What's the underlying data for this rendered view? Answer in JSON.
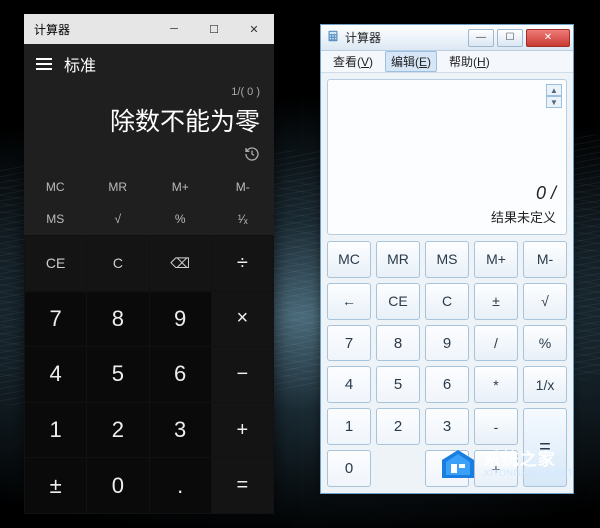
{
  "win10": {
    "title": "计算器",
    "mode": "标准",
    "expression": "1/( 0 )",
    "result": "除数不能为零",
    "history_icon": "history-icon",
    "memory_row": [
      "MC",
      "MR",
      "M+",
      "M-"
    ],
    "func_row": [
      "MS",
      "√",
      "%",
      "¹⁄ₓ"
    ],
    "keypad": [
      {
        "label": "CE",
        "cls": "fn"
      },
      {
        "label": "C",
        "cls": "fn"
      },
      {
        "label": "⌫",
        "cls": "fn"
      },
      {
        "label": "÷",
        "cls": "op"
      },
      {
        "label": "7",
        "cls": "num"
      },
      {
        "label": "8",
        "cls": "num"
      },
      {
        "label": "9",
        "cls": "num"
      },
      {
        "label": "×",
        "cls": "op"
      },
      {
        "label": "4",
        "cls": "num"
      },
      {
        "label": "5",
        "cls": "num"
      },
      {
        "label": "6",
        "cls": "num"
      },
      {
        "label": "−",
        "cls": "op"
      },
      {
        "label": "1",
        "cls": "num"
      },
      {
        "label": "2",
        "cls": "num"
      },
      {
        "label": "3",
        "cls": "num"
      },
      {
        "label": "+",
        "cls": "op"
      },
      {
        "label": "±",
        "cls": "num"
      },
      {
        "label": "0",
        "cls": "num"
      },
      {
        "label": ".",
        "cls": "num"
      },
      {
        "label": "=",
        "cls": "op"
      }
    ]
  },
  "win7": {
    "title": "计算器",
    "menu": [
      {
        "pre": "查看(",
        "mn": "V",
        "post": ")",
        "active": false
      },
      {
        "pre": "编辑(",
        "mn": "E",
        "post": ")",
        "active": true
      },
      {
        "pre": "帮助(",
        "mn": "H",
        "post": ")",
        "active": false
      }
    ],
    "display_value": "0 /",
    "display_message": "结果未定义",
    "pad": [
      {
        "label": "MC"
      },
      {
        "label": "MR"
      },
      {
        "label": "MS"
      },
      {
        "label": "M+"
      },
      {
        "label": "M-"
      },
      {
        "label": "←"
      },
      {
        "label": "CE"
      },
      {
        "label": "C"
      },
      {
        "label": "±"
      },
      {
        "label": "√"
      },
      {
        "label": "7",
        "cls": "num"
      },
      {
        "label": "8",
        "cls": "num"
      },
      {
        "label": "9",
        "cls": "num"
      },
      {
        "label": "/"
      },
      {
        "label": "%"
      },
      {
        "label": "4",
        "cls": "num"
      },
      {
        "label": "5",
        "cls": "num"
      },
      {
        "label": "6",
        "cls": "num"
      },
      {
        "label": "*"
      },
      {
        "label": "1/x"
      },
      {
        "label": "1",
        "cls": "num"
      },
      {
        "label": "2",
        "cls": "num"
      },
      {
        "label": "3",
        "cls": "num"
      },
      {
        "label": "-"
      },
      {
        "label": "=",
        "cls": "eq"
      },
      {
        "label": "0",
        "cls": "num"
      },
      {
        "label": "",
        "cls": "empty"
      },
      {
        "label": ".",
        "cls": "num"
      },
      {
        "label": "+"
      }
    ]
  },
  "watermark": {
    "cn": "系统之家",
    "en": "XITONGZHIJIA.NET"
  }
}
